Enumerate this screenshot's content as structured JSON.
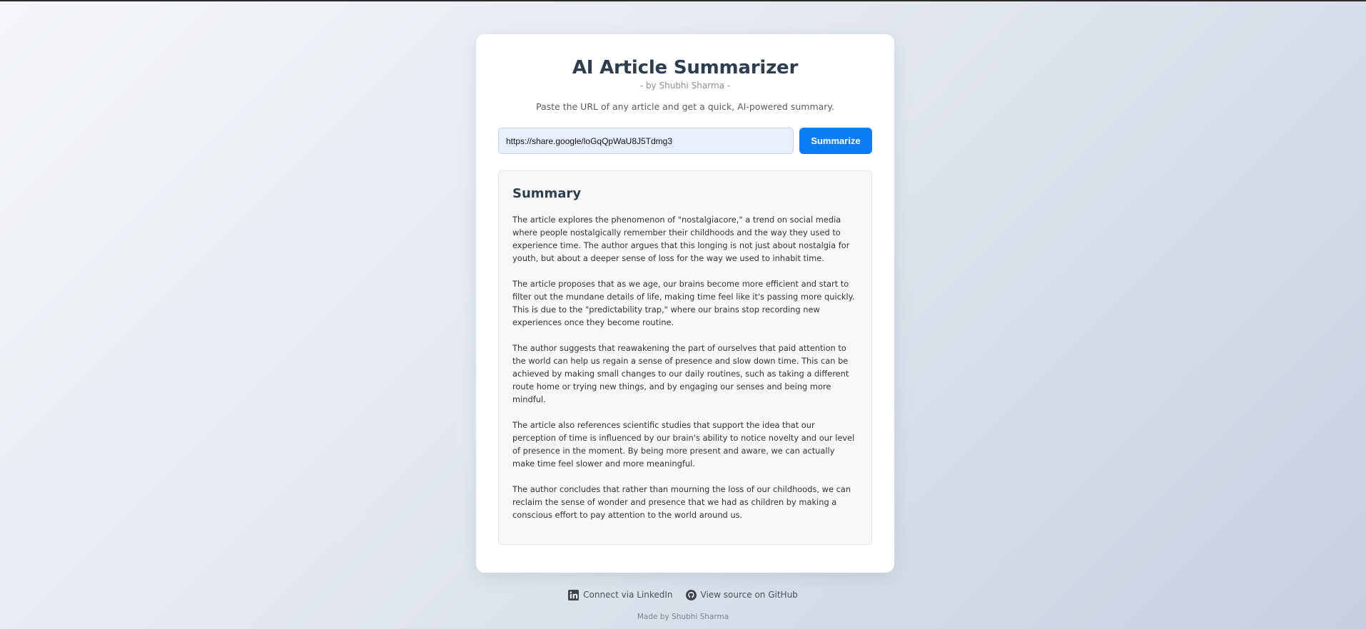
{
  "app": {
    "title": "AI Article Summarizer",
    "byline": "- by Shubhi Sharma -",
    "tagline": "Paste the URL of any article and get a quick, AI-powered summary."
  },
  "form": {
    "url_value": "https://share.google/loGqQpWaU8J5Tdmg3",
    "button_label": "Summarize"
  },
  "summary": {
    "heading": "Summary",
    "paragraphs": [
      "The article explores the phenomenon of \"nostalgiacore,\" a trend on social media where people nostalgically remember their childhoods and the way they used to experience time. The author argues that this longing is not just about nostalgia for youth, but about a deeper sense of loss for the way we used to inhabit time.",
      "The article proposes that as we age, our brains become more efficient and start to filter out the mundane details of life, making time feel like it's passing more quickly. This is due to the \"predictability trap,\" where our brains stop recording new experiences once they become routine.",
      "The author suggests that reawakening the part of ourselves that paid attention to the world can help us regain a sense of presence and slow down time. This can be achieved by making small changes to our daily routines, such as taking a different route home or trying new things, and by engaging our senses and being more mindful.",
      "The article also references scientific studies that support the idea that our perception of time is influenced by our brain's ability to notice novelty and our level of presence in the moment. By being more present and aware, we can actually make time feel slower and more meaningful.",
      "The author concludes that rather than mourning the loss of our childhoods, we can reclaim the sense of wonder and presence that we had as children by making a conscious effort to pay attention to the world around us."
    ]
  },
  "footer": {
    "linkedin_label": "Connect via LinkedIn",
    "linkedin_icon": "linkedin-icon",
    "github_label": "View source on GitHub",
    "github_icon": "github-icon",
    "made_by": "Made by Shubhi Sharma"
  },
  "colors": {
    "accent": "#0a7cf5",
    "title": "#2c3e50",
    "input_bg": "#e8f0fe"
  }
}
